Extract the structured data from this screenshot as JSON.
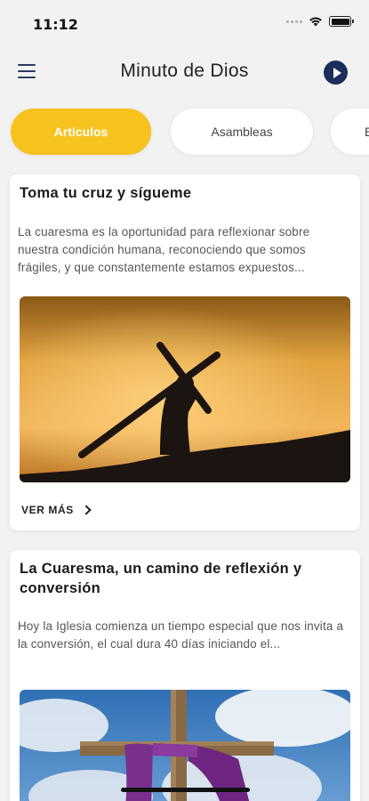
{
  "status": {
    "time": "11:12"
  },
  "header": {
    "title": "Minuto de Dios",
    "menu_icon": "hamburger-menu-icon",
    "play_icon": "play-circle-icon"
  },
  "tabs": [
    {
      "label": "Artículos",
      "active": true
    },
    {
      "label": "Asambleas",
      "active": false
    },
    {
      "label": "E",
      "active": false
    }
  ],
  "articles": [
    {
      "title": "Toma tu cruz y sígueme",
      "excerpt": "La cuaresma es la oportunidad para reflexionar sobre nuestra condición humana, reconociendo que somos frágiles, y que constantemente estamos expuestos...",
      "read_more": "VER MÁS"
    },
    {
      "title": "La Cuaresma, un camino de reflexión y conversión",
      "excerpt": "Hoy la Iglesia comienza un tiempo especial que nos invita a la conversión, el cual dura 40 días iniciando el..."
    }
  ],
  "colors": {
    "accent": "#f9c31f",
    "brand_navy": "#1b2d5a"
  }
}
